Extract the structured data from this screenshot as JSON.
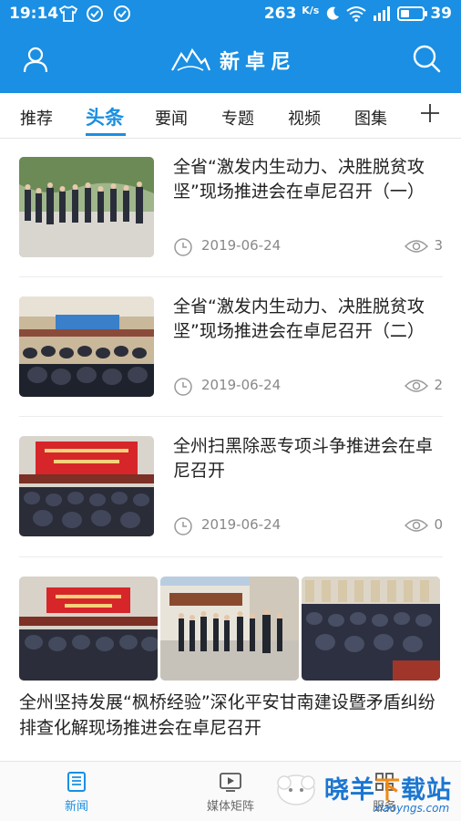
{
  "status_bar": {
    "time": "19:14",
    "speed": "263",
    "speed_unit": "K/s",
    "battery": "39",
    "battery_level": 0.39,
    "network": "4G"
  },
  "header": {
    "app_name": "新卓尼",
    "brand_color": "#1a8fe3",
    "left_icon": "user-icon",
    "right_icon": "search-icon"
  },
  "tabs": [
    {
      "label": "推荐",
      "active": false
    },
    {
      "label": "头条",
      "active": true
    },
    {
      "label": "要闻",
      "active": false
    },
    {
      "label": "专题",
      "active": false
    },
    {
      "label": "视频",
      "active": false
    },
    {
      "label": "图集",
      "active": false
    }
  ],
  "articles": [
    {
      "title": "全省“激发内生动力、决胜脱贫攻坚”现场推进会在卓尼召开（一）",
      "date": "2019-06-24",
      "views": "3",
      "thumb": "outdoor-group-photo"
    },
    {
      "title": "全省“激发内生动力、决胜脱贫攻坚”现场推进会在卓尼召开（二）",
      "date": "2019-06-24",
      "views": "2",
      "thumb": "conference-hall-photo"
    },
    {
      "title": "全州扫黑除恶专项斗争推进会在卓尼召开",
      "date": "2019-06-24",
      "views": "0",
      "thumb": "meeting-banner-photo"
    }
  ],
  "gallery_article": {
    "title": "全州坚持发展“枫桥经验”深化平安甘南建设暨矛盾纠纷排查化解现场推进会在卓尼召开",
    "images": [
      "meeting-banner-photo",
      "outdoor-inspection-photo",
      "auditorium-photo"
    ]
  },
  "tab_bar": [
    {
      "label": "新闻",
      "icon": "news-icon",
      "active": true
    },
    {
      "label": "媒体矩阵",
      "icon": "video-icon",
      "active": false
    },
    {
      "label": "服务",
      "icon": "service-icon",
      "active": false
    }
  ],
  "watermark": {
    "text_a": "晓羊",
    "text_b": "下",
    "text_c": "载站",
    "url": "xiaoyngs.com"
  }
}
